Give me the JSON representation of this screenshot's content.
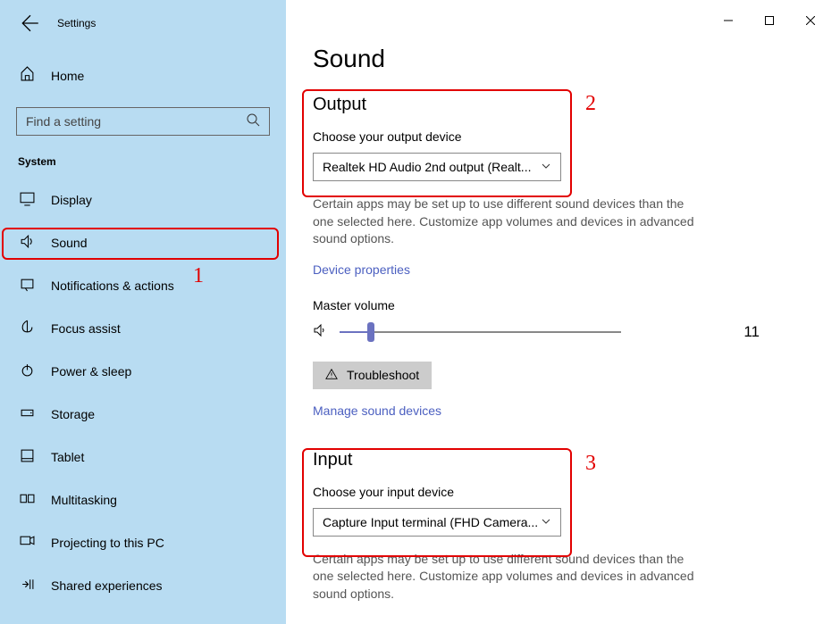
{
  "window": {
    "title": "Settings"
  },
  "sidebar": {
    "home": "Home",
    "search_placeholder": "Find a setting",
    "group": "System",
    "items": [
      {
        "label": "Display"
      },
      {
        "label": "Sound"
      },
      {
        "label": "Notifications & actions"
      },
      {
        "label": "Focus assist"
      },
      {
        "label": "Power & sleep"
      },
      {
        "label": "Storage"
      },
      {
        "label": "Tablet"
      },
      {
        "label": "Multitasking"
      },
      {
        "label": "Projecting to this PC"
      },
      {
        "label": "Shared experiences"
      }
    ]
  },
  "page": {
    "title": "Sound",
    "output": {
      "heading": "Output",
      "device_label": "Choose your output device",
      "device_value": "Realtek HD Audio 2nd output (Realt...",
      "help": "Certain apps may be set up to use different sound devices than the one selected here. Customize app volumes and devices in advanced sound options.",
      "device_properties": "Device properties",
      "master_volume_label": "Master volume",
      "master_volume_value": "11",
      "troubleshoot": "Troubleshoot",
      "manage": "Manage sound devices"
    },
    "input": {
      "heading": "Input",
      "device_label": "Choose your input device",
      "device_value": "Capture Input terminal (FHD Camera...",
      "help": "Certain apps may be set up to use different sound devices than the one selected here. Customize app volumes and devices in advanced sound options."
    }
  },
  "annotations": {
    "a1": "1",
    "a2": "2",
    "a3": "3"
  }
}
